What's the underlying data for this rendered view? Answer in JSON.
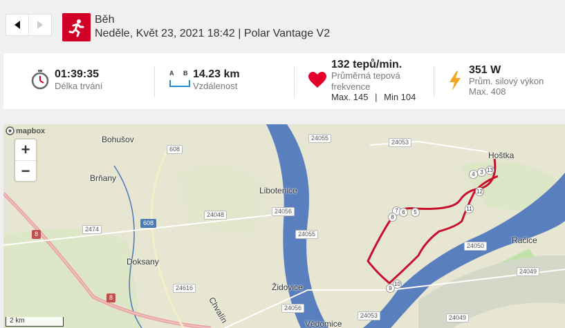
{
  "header": {
    "title": "Běh",
    "subtitle": "Neděle, Květ 23, 2021 18:42 | Polar Vantage V2"
  },
  "stats": {
    "duration": {
      "value": "01:39:35",
      "label": "Délka trvání"
    },
    "distance": {
      "value": "14.23 km",
      "label": "Vzdálenost",
      "icon_a": "A",
      "icon_b": "B"
    },
    "heart_rate": {
      "value": "132 tepů/min.",
      "label_line1": "Průměrná tepová",
      "label_line2": "frekvence",
      "max": "Max. 145",
      "sep": "|",
      "min": "Min 104"
    },
    "power": {
      "value": "351 W",
      "label": "Prům. silový výkon",
      "max": "Max. 408"
    }
  },
  "map": {
    "attribution": "mapbox",
    "zoom_in": "+",
    "zoom_out": "−",
    "scale": "2 km",
    "places": [
      "Bohušov",
      "Brňany",
      "Doksany",
      "Libotenice",
      "Židovice",
      "Hoštka",
      "Račice",
      "Vědomice",
      "Chvalín"
    ],
    "roads": [
      "608",
      "608",
      "8",
      "8",
      "2474",
      "24048",
      "24056",
      "24055",
      "24055",
      "24053",
      "24056",
      "24053",
      "24050",
      "24049",
      "24049",
      "24616"
    ],
    "laps": [
      "4",
      "3",
      "13",
      "12",
      "11",
      "7",
      "6",
      "5",
      "8",
      "10",
      "9"
    ]
  },
  "colors": {
    "accent": "#d10027",
    "route": "#c8102e",
    "water": "#5a7fbf",
    "power_icon": "#f5a623"
  }
}
